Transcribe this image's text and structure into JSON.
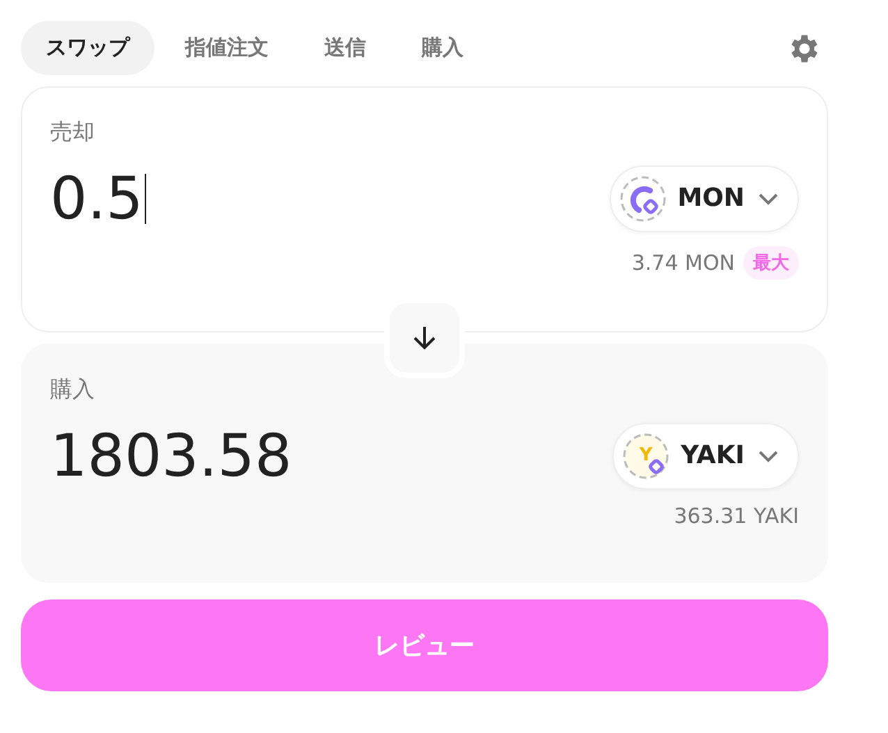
{
  "tabs": [
    {
      "label": "スワップ",
      "selected": true
    },
    {
      "label": "指値注文",
      "selected": false
    },
    {
      "label": "送信",
      "selected": false
    },
    {
      "label": "購入",
      "selected": false
    }
  ],
  "sell": {
    "label": "売却",
    "amount": "0.5",
    "focused": true,
    "token": {
      "symbol": "MON",
      "kind": "mon"
    },
    "balance": "3.74 MON",
    "max_label": "最大"
  },
  "buy": {
    "label": "購入",
    "amount": "1803.58",
    "token": {
      "symbol": "YAKI",
      "kind": "letter",
      "logo_letter": "Y"
    },
    "balance": "363.31 YAKI"
  },
  "review_button": "レビュー"
}
